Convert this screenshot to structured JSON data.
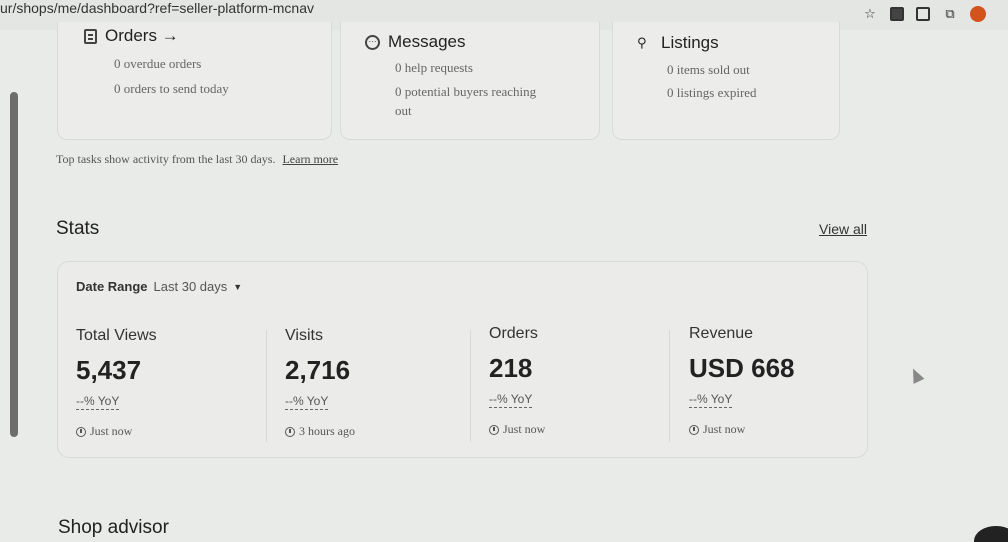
{
  "browser": {
    "url": "ur/shops/me/dashboard?ref=seller-platform-mcnav",
    "icons": [
      "star-icon",
      "extension-1-icon",
      "extension-2-icon",
      "extensions-puzzle-icon",
      "profile-avatar"
    ]
  },
  "tasks": [
    {
      "title": "Orders →",
      "icon": "document-icon",
      "lines": [
        "0 overdue orders",
        "0 orders to send today"
      ]
    },
    {
      "title": "Messages",
      "icon": "chat-bubble-icon",
      "lines": [
        "0 help requests",
        "0 potential buyers reaching",
        "out"
      ]
    },
    {
      "title": "Listings",
      "icon": "shapes-icon",
      "lines": [
        "0 items sold out",
        "0 listings expired"
      ]
    }
  ],
  "footnote": {
    "text": "Top tasks show activity from the last 30 days.",
    "link": "Learn more"
  },
  "stats": {
    "title": "Stats",
    "view_all": "View all",
    "date_range_label": "Date Range",
    "date_range_value": "Last 30 days",
    "metrics": [
      {
        "label": "Total Views",
        "value": "5,437",
        "yoy": "--% YoY",
        "time": "Just now"
      },
      {
        "label": "Visits",
        "value": "2,716",
        "yoy": "--% YoY",
        "time": "3 hours ago"
      },
      {
        "label": "Orders",
        "value": "218",
        "yoy": "--% YoY",
        "time": "Just now"
      },
      {
        "label": "Revenue",
        "value": "USD 668",
        "yoy": "--% YoY",
        "time": "Just now"
      }
    ]
  },
  "shop_advisor": {
    "title": "Shop advisor"
  },
  "colors": {
    "background": "#e9ebe8",
    "card_border": "#d8dad7",
    "accent_profile": "#d4531d"
  }
}
